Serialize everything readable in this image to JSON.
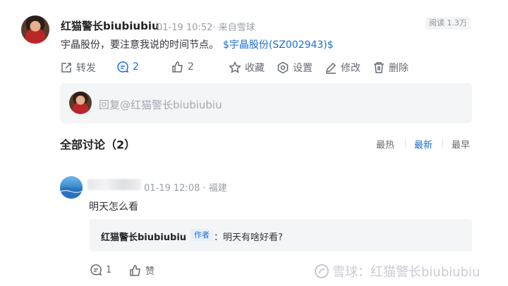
{
  "post": {
    "username": "红猫警长biubiubiu",
    "meta": "01-19 10:52· 来自雪球",
    "read_count": "阅读 1.3万",
    "text": "宇晶股份，要注意我说的时间节点。",
    "stock_link": "$宇晶股份(SZ002943)$"
  },
  "actions": {
    "repost": "转发",
    "comment_count": "2",
    "like_count": "2",
    "favorite": "收藏",
    "settings": "设置",
    "edit": "修改",
    "delete": "删除"
  },
  "reply": {
    "placeholder": "回复@红猫警长biubiubiu"
  },
  "discussion": {
    "title": "全部讨论（2）",
    "sort_hot": "最热",
    "sort_new": "最新",
    "sort_early": "最早",
    "active_sort": "最新"
  },
  "comment": {
    "meta": "01-19 12:08 · 福建",
    "text": "明天怎么看",
    "quote_user": "红猫警长biubiubiu",
    "quote_tag": "作者",
    "quote_colon": "：",
    "quote_text": "明天有啥好看?",
    "reply_count": "1",
    "like_label": "赞"
  },
  "watermark": {
    "text": "雪球：红猫警长biubiubiu"
  }
}
